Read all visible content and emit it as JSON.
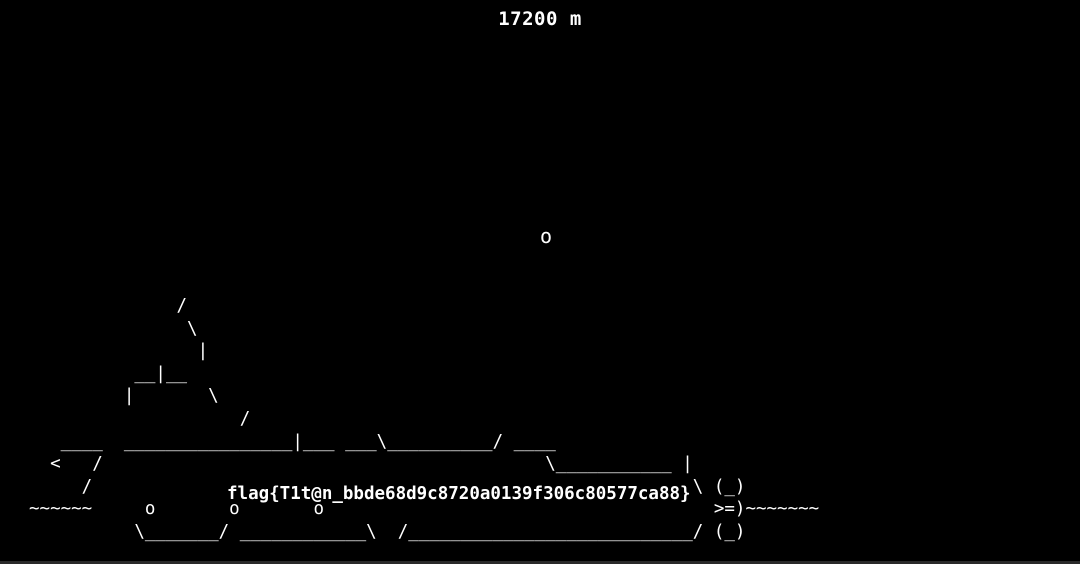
{
  "hud": {
    "depth": "17200 m"
  },
  "bubble": "o",
  "submarine_art": "              /\n               \\\n                |\n          __|__\n         |       \\\n                    /\n   ____  ________________|___ ___\\__________/ ____\n  <   /                                          \\___________ |\n     /                                                         \\ (_)\n~~~~~~     o       o       o                                     >=)~~~~~~~\n          \\_______/ ____________\\  /___________________________/ (_)",
  "flag": "flag{T1t@n_bbde68d9c8720a0139f306c80577ca88}",
  "colors": {
    "background": "#000000",
    "text": "#ffffff"
  }
}
